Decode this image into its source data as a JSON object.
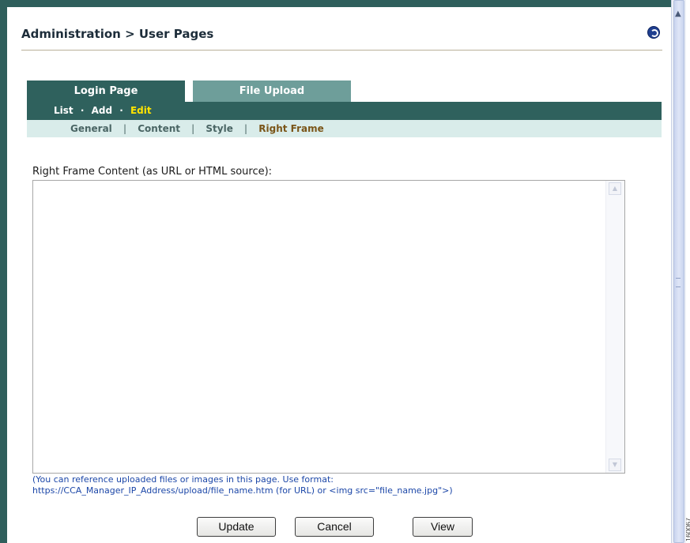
{
  "header": {
    "title": "Administration > User Pages",
    "help_icon": "help-circle-icon"
  },
  "tabs": [
    {
      "label": "Login Page",
      "active": true
    },
    {
      "label": "File Upload",
      "active": false
    }
  ],
  "subnav": {
    "list": "List",
    "add": "Add",
    "edit": "Edit",
    "separator": "·"
  },
  "subtabs": {
    "general": "General",
    "content": "Content",
    "style": "Style",
    "right_frame": "Right Frame",
    "separator": "|"
  },
  "form": {
    "label": "Right Frame Content (as URL or HTML source):",
    "value": "",
    "hint_line1": "(You can reference uploaded files or images in this page. Use format:",
    "hint_line2": "https://CCA_Manager_IP_Address/upload/file_name.htm (for URL) or <img src=\"file_name.jpg\">)"
  },
  "buttons": {
    "update": "Update",
    "cancel": "Cancel",
    "view": "View"
  },
  "figure_id": "160067",
  "colors": {
    "tab_active": "#2f615d",
    "tab_inactive": "#6e9e9a",
    "subtab_bg": "#d9ecea",
    "active_link": "#ffe400",
    "active_subtab": "#7a5518",
    "hint": "#1c47a8"
  }
}
